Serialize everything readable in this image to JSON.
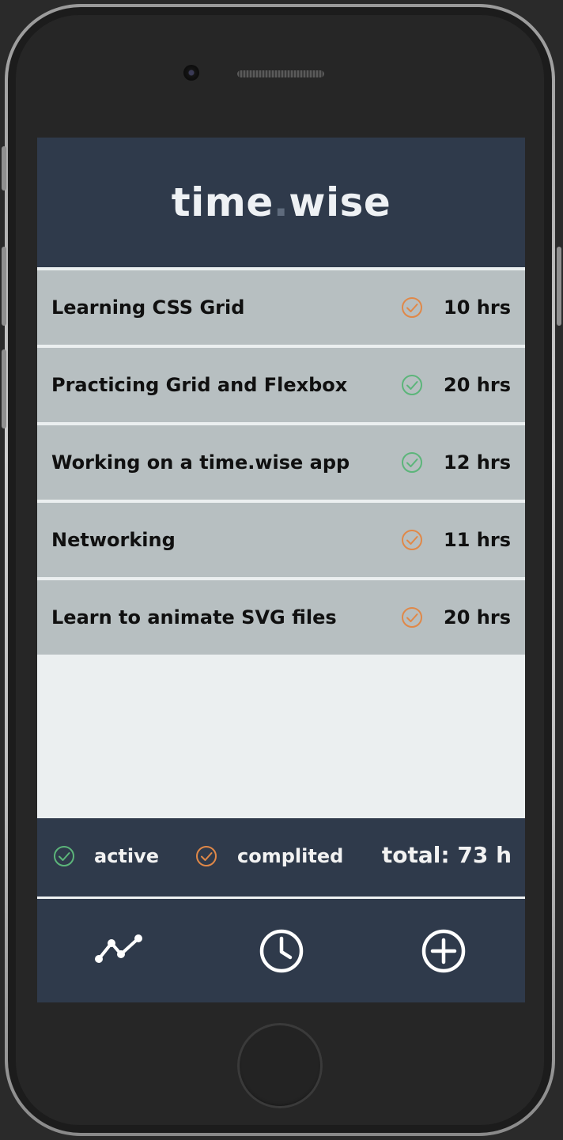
{
  "app": {
    "logo_left": "time",
    "logo_dot": ".",
    "logo_right": "wise"
  },
  "colors": {
    "header_bg": "#2f3a4b",
    "row_bg": "#b7bfc1",
    "active_green": "#5cb57a",
    "completed_orange": "#e08848",
    "screen_bg": "#ebeff0"
  },
  "tasks": [
    {
      "title": "Learning CSS Grid",
      "status": "completed",
      "hours": "10 hrs"
    },
    {
      "title": "Practicing Grid and Flexbox",
      "status": "active",
      "hours": "20 hrs"
    },
    {
      "title": "Working on a time.wise app",
      "status": "active",
      "hours": "12 hrs"
    },
    {
      "title": "Networking",
      "status": "completed",
      "hours": "11 hrs"
    },
    {
      "title": "Learn to animate SVG files",
      "status": "completed",
      "hours": "20 hrs"
    }
  ],
  "legend": {
    "active_label": "active",
    "completed_label": "complited",
    "total_label": "total: 73 h"
  },
  "nav": [
    {
      "icon": "chart-line-icon"
    },
    {
      "icon": "clock-icon"
    },
    {
      "icon": "add-circle-icon"
    }
  ]
}
